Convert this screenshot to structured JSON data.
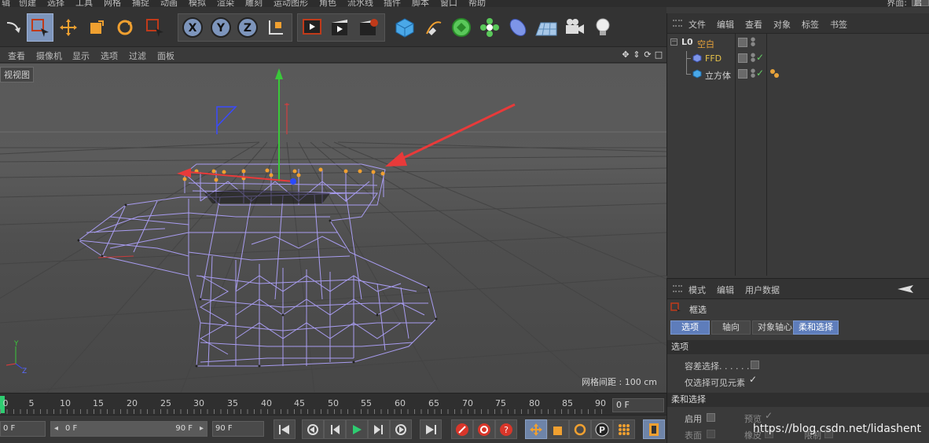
{
  "menubar": {
    "items": [
      "辑",
      "创建",
      "选择",
      "工具",
      "网格",
      "捕捉",
      "动画",
      "模拟",
      "渲染",
      "雕刻",
      "运动图形",
      "角色",
      "流水线",
      "插件",
      "脚本",
      "窗口",
      "帮助"
    ],
    "layout_label": "界面:",
    "layout_value": "启"
  },
  "toolbar": {
    "axis_x": "X",
    "axis_y": "Y",
    "axis_z": "Z"
  },
  "viewport_menu": {
    "items": [
      "查看",
      "摄像机",
      "显示",
      "选项",
      "过滤",
      "面板"
    ]
  },
  "viewport": {
    "name": "视视图",
    "grid_spacing": "网格间距 : 100 cm",
    "axis_labels": {
      "y": "Y",
      "z": "Z"
    }
  },
  "timeline": {
    "ticks": [
      "0",
      "5",
      "10",
      "15",
      "20",
      "25",
      "30",
      "35",
      "40",
      "45",
      "50",
      "55",
      "60",
      "65",
      "70",
      "75",
      "80",
      "85",
      "90"
    ],
    "current_frame": "0 F"
  },
  "transport": {
    "start_field": "0 F",
    "range_start": "0 F",
    "range_end": "90 F",
    "end_field": "90 F"
  },
  "object_manager": {
    "tabs": [
      "文件",
      "编辑",
      "查看",
      "对象",
      "标签",
      "书签"
    ],
    "objects": [
      {
        "name": "空白",
        "color": "#e8a33a",
        "icon": "null-icon"
      },
      {
        "name": "FFD",
        "color": "#e6c24a",
        "icon": "ffd-icon"
      },
      {
        "name": "立方体",
        "color": "#d2d2d2",
        "icon": "cube-icon"
      }
    ]
  },
  "attribute_manager": {
    "tabs": [
      "模式",
      "编辑",
      "用户数据"
    ],
    "tool_name": "框选",
    "subtabs": [
      "选项",
      "轴向",
      "对象轴心",
      "柔和选择"
    ],
    "section_options": "选项",
    "tolerant_select": "容差选择. . . . . .",
    "visible_only": "仅选择可见元素",
    "section_soft": "柔和选择",
    "enable": "启用",
    "preview": "预览",
    "surface": "表面",
    "rubber": "橡皮",
    "restrict": "限制"
  },
  "colors": {
    "accent": "#5e7dbb",
    "wireframe": "#a89cf0",
    "points": "#f0a030",
    "arrow": "#e83a3a"
  },
  "watermark": "https://blog.csdn.net/lidashent"
}
